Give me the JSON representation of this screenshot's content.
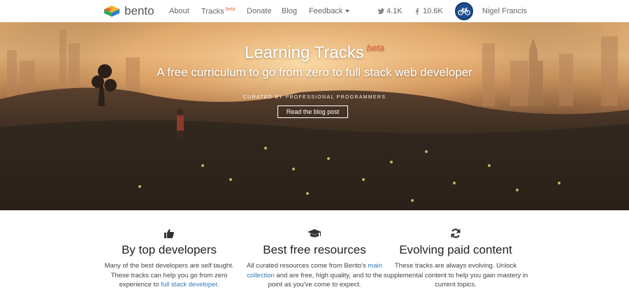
{
  "nav": {
    "brand": "bento",
    "links": {
      "about": "About",
      "tracks": "Tracks",
      "tracks_badge": "beta",
      "donate": "Donate",
      "blog": "Blog",
      "feedback": "Feedback"
    },
    "twitter_count": "4.1K",
    "facebook_count": "10.6K",
    "user_name": "Nigel Francis"
  },
  "hero": {
    "title": "Learning Tracks",
    "title_badge": "beta",
    "subtitle": "A free curriculum to go from zero to full stack web developer",
    "curated": "CURATED BY PROFESSIONAL PROGRAMMERS",
    "button": "Read the blog post"
  },
  "features": [
    {
      "icon": "thumbs-up-icon",
      "title": "By top developers",
      "text_before": "Many of the best developers are self taught. These tracks can help you go from zero experience to ",
      "link": "full stack developer.",
      "text_after": ""
    },
    {
      "icon": "graduation-cap-icon",
      "title": "Best free resources",
      "text_before": "All curated resources come from Bento's ",
      "link": "main collection",
      "text_after": " and are free, high quality, and to the point as you've come to expect."
    },
    {
      "icon": "refresh-icon",
      "title": "Evolving paid content",
      "text_before": "These tracks are always evolving. Unlock supplemental content to help you gain mastery in current topics.",
      "link": "",
      "text_after": ""
    }
  ],
  "colors": {
    "accent_beta": "#e8603c",
    "link": "#337ab7",
    "avatar_bg": "#1d4d8c"
  }
}
